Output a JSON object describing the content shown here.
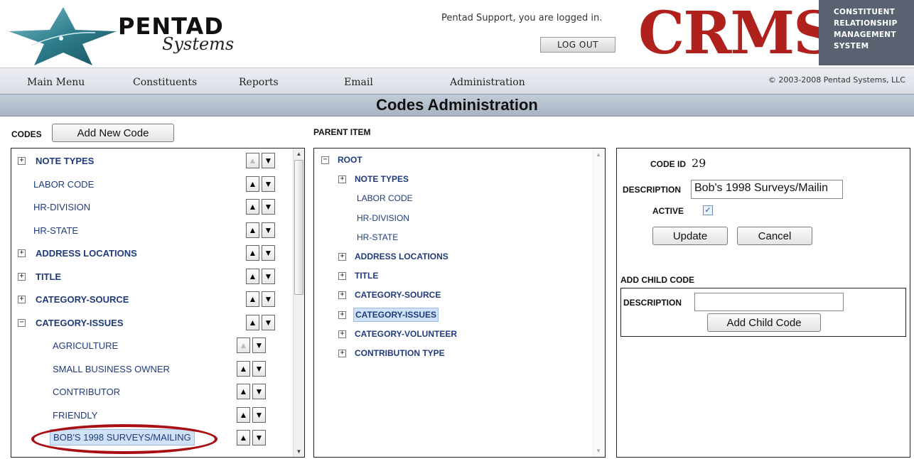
{
  "header": {
    "logo_main": "PENTAD",
    "logo_sub": "Systems",
    "logged_in_text": "Pentad Support, you are logged in.",
    "logout_label": "LOG OUT",
    "crms": "CRMS",
    "crms_tagline": [
      "CONSTITUENT",
      "RELATIONSHIP",
      "MANAGEMENT",
      "SYSTEM"
    ]
  },
  "nav": {
    "items": [
      "Main Menu",
      "Constituents",
      "Reports",
      "Email",
      "Administration"
    ],
    "copyright": "© 2003-2008 Pentad Systems, LLC"
  },
  "page_title": "Codes Administration",
  "codes": {
    "label": "CODES",
    "add_new_label": "Add New Code",
    "items": [
      {
        "label": "NOTE TYPES",
        "expander": "+",
        "up_disabled": true
      },
      {
        "label": "LABOR CODE"
      },
      {
        "label": "HR-DIVISION"
      },
      {
        "label": "HR-STATE"
      },
      {
        "label": "ADDRESS LOCATIONS",
        "expander": "+"
      },
      {
        "label": "TITLE",
        "expander": "+"
      },
      {
        "label": "CATEGORY-SOURCE",
        "expander": "+"
      },
      {
        "label": "CATEGORY-ISSUES",
        "expander": "−"
      },
      {
        "label": "AGRICULTURE",
        "up_disabled": true
      },
      {
        "label": "SMALL BUSINESS OWNER"
      },
      {
        "label": "CONTRIBUTOR"
      },
      {
        "label": "FRIENDLY"
      },
      {
        "label": "BOB'S 1998 SURVEYS/MAILING",
        "selected": true
      }
    ]
  },
  "parent": {
    "label": "PARENT ITEM",
    "items": [
      {
        "label": "ROOT",
        "expander": "−"
      },
      {
        "label": "NOTE TYPES",
        "expander": "+"
      },
      {
        "label": "LABOR CODE"
      },
      {
        "label": "HR-DIVISION"
      },
      {
        "label": "HR-STATE"
      },
      {
        "label": "ADDRESS LOCATIONS",
        "expander": "+"
      },
      {
        "label": "TITLE",
        "expander": "+"
      },
      {
        "label": "CATEGORY-SOURCE",
        "expander": "+"
      },
      {
        "label": "CATEGORY-ISSUES",
        "expander": "+",
        "selected": true
      },
      {
        "label": "CATEGORY-VOLUNTEER",
        "expander": "+"
      },
      {
        "label": "CONTRIBUTION TYPE",
        "expander": "+"
      }
    ]
  },
  "edit": {
    "code_id_label": "CODE ID",
    "code_id_value": "29",
    "description_label": "DESCRIPTION",
    "description_value": "Bob's 1998 Surveys/Mailin",
    "active_label": "ACTIVE",
    "active_checked": true,
    "update_label": "Update",
    "cancel_label": "Cancel",
    "add_child_heading": "ADD CHILD CODE",
    "child_description_label": "DESCRIPTION",
    "child_description_value": "",
    "add_child_button": "Add Child Code"
  },
  "icons": {
    "up": "▲",
    "down": "▼",
    "check": "✓"
  },
  "colors": {
    "brand_red": "#b0201d",
    "link_blue": "#1f3b7a",
    "selection_bg": "#cfe2f7",
    "highlight_circle": "#a80e12"
  }
}
